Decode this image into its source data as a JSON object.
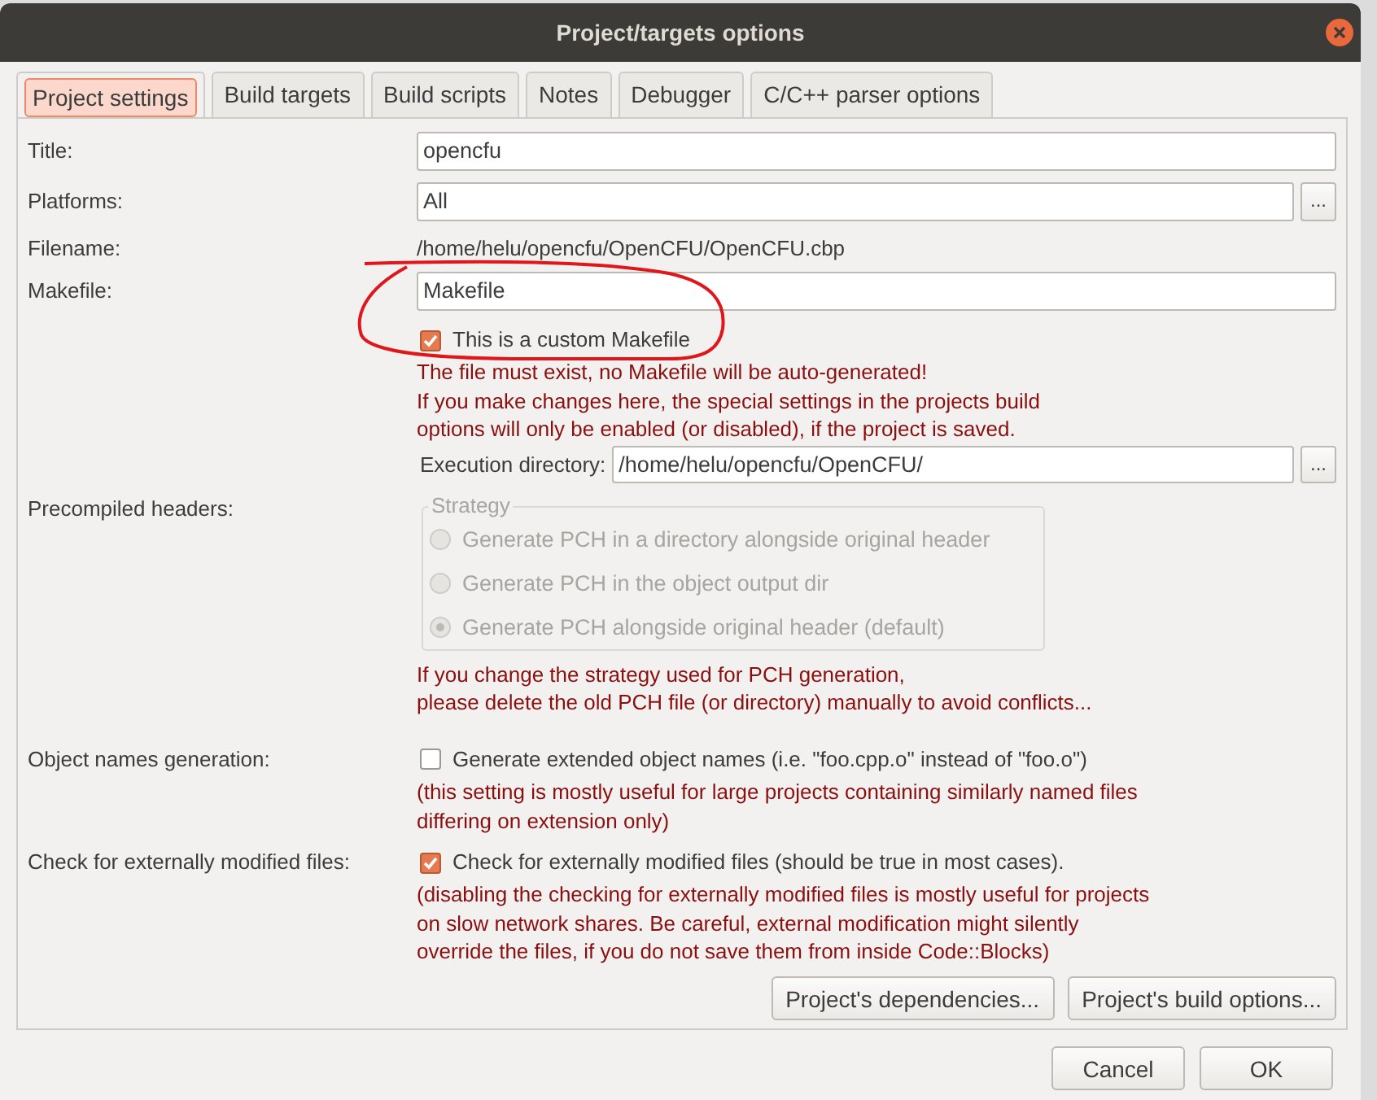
{
  "window": {
    "title": "Project/targets options"
  },
  "tabs": [
    {
      "label": "Project settings",
      "selected": true
    },
    {
      "label": "Build targets",
      "selected": false
    },
    {
      "label": "Build scripts",
      "selected": false
    },
    {
      "label": "Notes",
      "selected": false
    },
    {
      "label": "Debugger",
      "selected": false
    },
    {
      "label": "C/C++ parser options",
      "selected": false
    }
  ],
  "rows": [
    {
      "label": "Title:",
      "items": [
        {
          "kind": "input",
          "value": "opencfu"
        }
      ]
    },
    {
      "label": "Platforms:",
      "items": [
        {
          "kind": "input",
          "value": "All",
          "browse_button": "..."
        }
      ]
    },
    {
      "label": "Filename:",
      "items": [
        {
          "kind": "path",
          "value": "/home/helu/opencfu/OpenCFU/OpenCFU.cbp"
        }
      ]
    },
    {
      "label": "Makefile:",
      "items": [
        {
          "kind": "input",
          "value": "Makefile"
        },
        {
          "kind": "checkbox",
          "label": "This is a custom Makefile",
          "checked": true
        },
        {
          "kind": "note",
          "text": "The file must exist, no Makefile will be auto-generated!\nIf you make changes here, the special settings in the projects build\noptions will only be enabled (or disabled), if the project is saved."
        },
        {
          "kind": "labeled_input",
          "label": "Execution directory:",
          "value": "/home/helu/opencfu/OpenCFU/",
          "browse_button": "..."
        }
      ]
    },
    {
      "label": "Precompiled headers:",
      "items": [
        {
          "kind": "radio_group",
          "title": "Strategy",
          "disabled": true,
          "options": [
            {
              "label": "Generate PCH in a directory alongside original header",
              "selected": false
            },
            {
              "label": "Generate PCH in the object output dir",
              "selected": false
            },
            {
              "label": "Generate PCH alongside original header (default)",
              "selected": true
            }
          ]
        },
        {
          "kind": "note",
          "text": "If you change the strategy used for PCH generation,\nplease delete the old PCH file (or directory) manually to avoid conflicts..."
        }
      ]
    },
    {
      "label": "Object names generation:",
      "items": [
        {
          "kind": "checkbox",
          "label": "Generate extended object names (i.e. \"foo.cpp.o\" instead of \"foo.o\")",
          "checked": false
        },
        {
          "kind": "note",
          "text": "(this setting is mostly useful for large projects containing similarly named files\ndiffering on extension only)"
        }
      ]
    },
    {
      "label": "Check for externally modified files:",
      "items": [
        {
          "kind": "checkbox",
          "label": "Check for externally modified files (should be true in most cases).",
          "checked": true
        },
        {
          "kind": "note",
          "text": "(disabling the checking for externally modified files is mostly useful for projects\non slow network shares. Be careful, external modification might silently\noverride the files, if you do not save them from inside Code::Blocks)"
        }
      ]
    }
  ],
  "panel_buttons": [
    "Project's dependencies...",
    "Project's build options..."
  ],
  "dialog_buttons": [
    "Cancel",
    "OK"
  ]
}
